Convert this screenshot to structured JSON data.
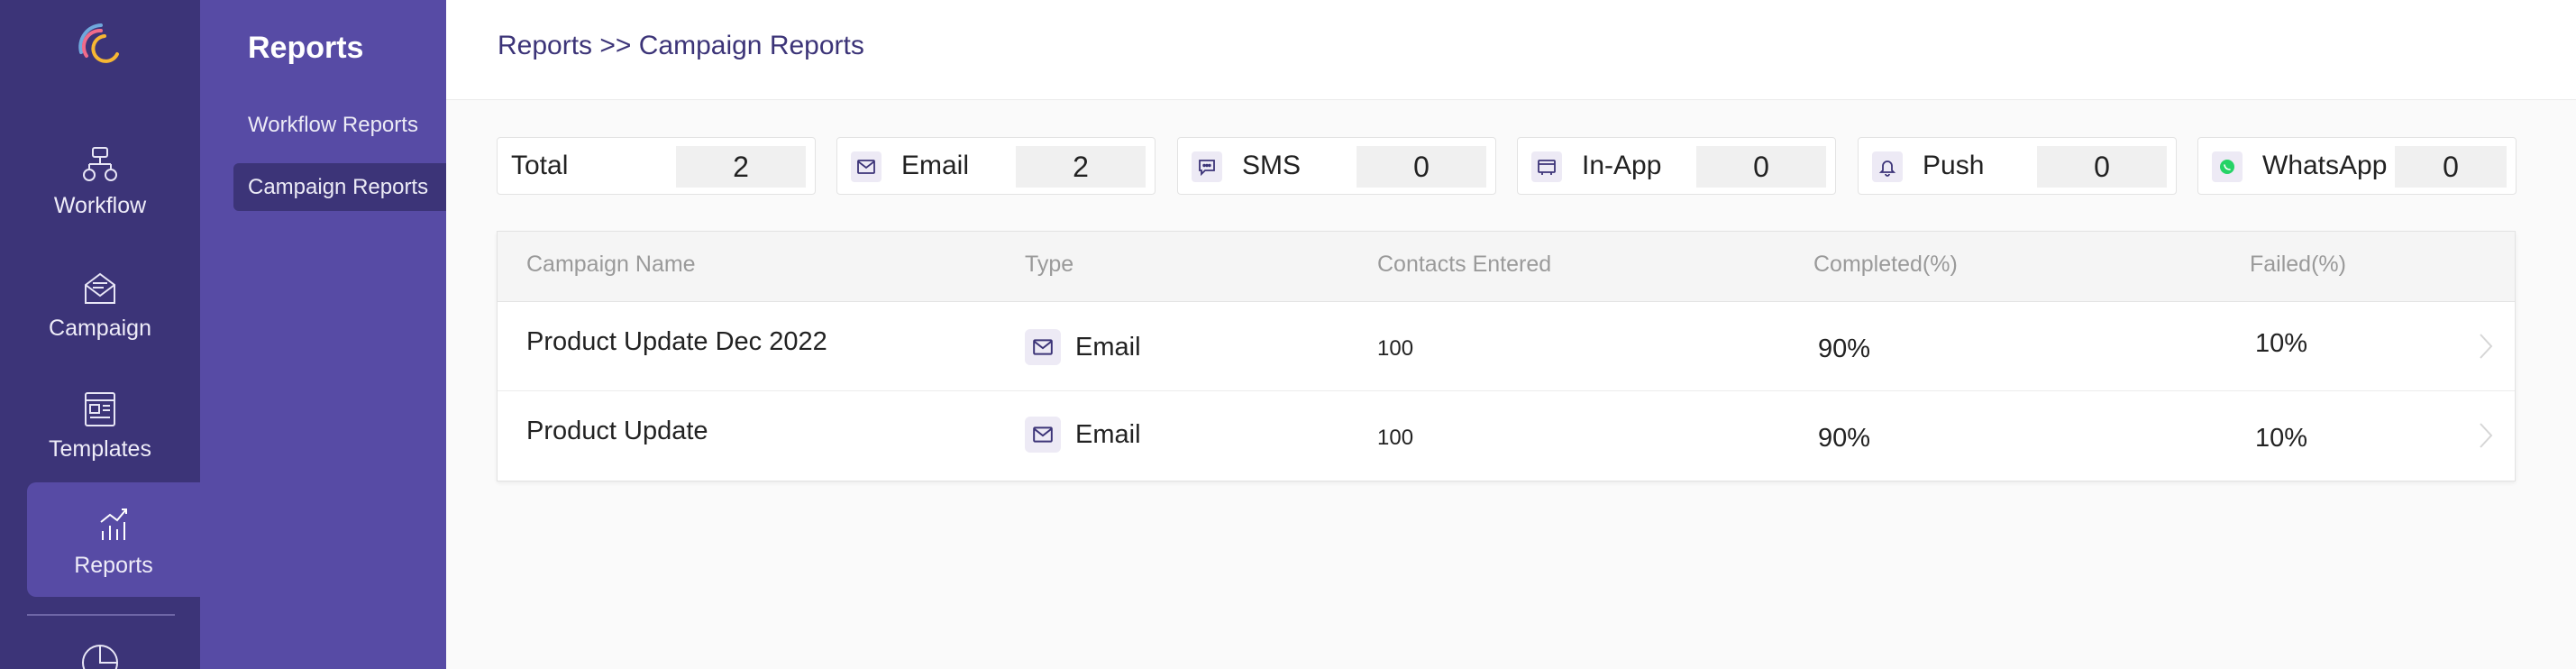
{
  "nav": {
    "items": [
      {
        "label": "Workflow",
        "icon": "workflow-icon"
      },
      {
        "label": "Campaign",
        "icon": "campaign-icon"
      },
      {
        "label": "Templates",
        "icon": "templates-icon"
      },
      {
        "label": "Reports",
        "icon": "reports-icon",
        "active": true
      }
    ],
    "partial_icon": "pie-chart-icon"
  },
  "subnav": {
    "title": "Reports",
    "items": [
      {
        "label": "Workflow Reports"
      },
      {
        "label": "Campaign Reports",
        "active": true
      }
    ]
  },
  "header": {
    "breadcrumb": "Reports >> Campaign Reports"
  },
  "stats": [
    {
      "label": "Total",
      "value": "2",
      "icon": null
    },
    {
      "label": "Email",
      "value": "2",
      "icon": "mail-icon"
    },
    {
      "label": "SMS",
      "value": "0",
      "icon": "sms-icon"
    },
    {
      "label": "In-App",
      "value": "0",
      "icon": "in-app-icon"
    },
    {
      "label": "Push",
      "value": "0",
      "icon": "bell-icon"
    },
    {
      "label": "WhatsApp",
      "value": "0",
      "icon": "whatsapp-icon"
    }
  ],
  "table": {
    "columns": [
      "Campaign Name",
      "Type",
      "Contacts Entered",
      "Completed(%)",
      "Failed(%)"
    ],
    "rows": [
      {
        "name": "Product Update Dec 2022",
        "type": "Email",
        "contacts": "100",
        "completed": "90%",
        "failed": "10%"
      },
      {
        "name": "Product Update",
        "type": "Email",
        "contacts": "100",
        "completed": "90%",
        "failed": "10%"
      }
    ]
  },
  "colors": {
    "rail": "#3c3478",
    "subnav": "#574ba5",
    "accent": "#3c3478",
    "whatsapp": "#25d366"
  }
}
